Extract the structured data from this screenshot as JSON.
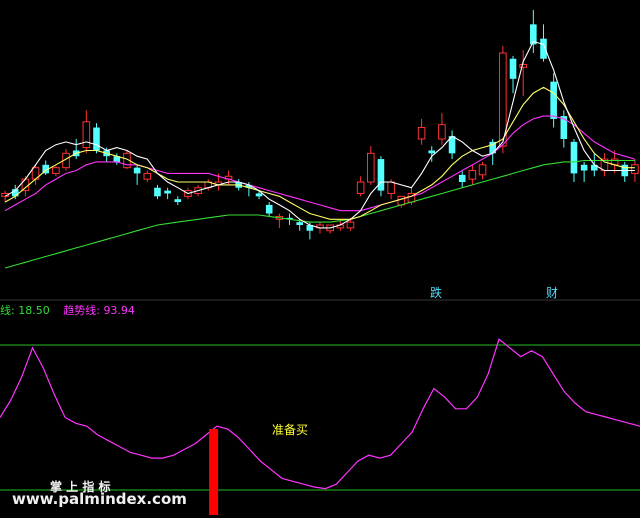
{
  "colors": {
    "up": "#ff3232",
    "down": "#54ffff",
    "ma_fast": "#ffffff",
    "ma_mid": "#ffff66",
    "ma_slow": "#ff33ff",
    "ma_long": "#33dd33",
    "indicator": "#ff33ff",
    "level_line": "#22bb22",
    "signal_bar": "#ff0000",
    "tag_label": "#55ddff",
    "buy_label": "#ffff33"
  },
  "indicator_header": {
    "line_a_label": "线:",
    "line_a_value": "18.50",
    "line_b_label": "趋势线:",
    "line_b_value": "93.94"
  },
  "tags": {
    "fall": "跌",
    "wealth": "财"
  },
  "signal_label": "准备买",
  "watermark": {
    "brand": "掌 上 指 标",
    "url": "www.palmindex.com"
  },
  "chart_data": [
    {
      "type": "candlestick",
      "title": "",
      "ylim": [
        0,
        100
      ],
      "candles": [
        [
          40,
          42,
          36,
          44
        ],
        [
          45,
          40,
          38,
          48
        ],
        [
          44,
          52,
          40,
          54
        ],
        [
          52,
          60,
          48,
          62
        ],
        [
          62,
          56,
          55,
          65
        ],
        [
          56,
          60,
          54,
          61
        ],
        [
          60,
          70,
          58,
          73
        ],
        [
          72,
          68,
          66,
          80
        ],
        [
          74,
          92,
          70,
          100
        ],
        [
          88,
          72,
          70,
          91
        ],
        [
          72,
          68,
          64,
          74
        ],
        [
          68,
          64,
          62,
          70
        ],
        [
          60,
          70,
          59,
          72
        ],
        [
          60,
          56,
          48,
          62
        ],
        [
          52,
          56,
          50,
          58
        ],
        [
          46,
          40,
          38,
          48
        ],
        [
          44,
          42,
          38,
          46
        ],
        [
          38,
          36,
          34,
          40
        ],
        [
          40,
          44,
          38,
          46
        ],
        [
          42,
          46,
          40,
          48
        ],
        [
          46,
          50,
          44,
          52
        ],
        [
          48,
          50,
          44,
          56
        ],
        [
          52,
          54,
          48,
          58
        ],
        [
          50,
          46,
          44,
          52
        ],
        [
          48,
          46,
          40,
          50
        ],
        [
          42,
          40,
          38,
          44
        ],
        [
          34,
          28,
          26,
          36
        ],
        [
          24,
          26,
          18,
          28
        ],
        [
          25,
          24,
          20,
          28
        ],
        [
          22,
          20,
          16,
          24
        ],
        [
          20,
          16,
          10,
          22
        ],
        [
          18,
          20,
          14,
          22
        ],
        [
          16,
          20,
          14,
          20
        ],
        [
          18,
          20,
          16,
          24
        ],
        [
          18,
          22,
          16,
          25
        ],
        [
          42,
          50,
          40,
          54
        ],
        [
          50,
          70,
          48,
          75
        ],
        [
          66,
          44,
          40,
          68
        ],
        [
          42,
          50,
          38,
          52
        ],
        [
          34,
          40,
          32,
          40
        ],
        [
          36,
          42,
          34,
          46
        ],
        [
          80,
          88,
          76,
          94
        ],
        [
          72,
          70,
          64,
          75
        ],
        [
          80,
          90,
          76,
          98
        ],
        [
          82,
          70,
          66,
          86
        ],
        [
          55,
          50,
          46,
          58
        ],
        [
          52,
          58,
          48,
          62
        ],
        [
          55,
          62,
          52,
          64
        ],
        [
          78,
          70,
          62,
          80
        ],
        [
          75,
          140,
          70,
          145
        ],
        [
          136,
          122,
          112,
          138
        ],
        [
          130,
          132,
          110,
          142
        ],
        [
          160,
          146,
          140,
          170
        ],
        [
          150,
          136,
          134,
          160
        ],
        [
          120,
          94,
          88,
          126
        ],
        [
          96,
          80,
          74,
          100
        ],
        [
          78,
          56,
          50,
          80
        ],
        [
          62,
          58,
          50,
          64
        ],
        [
          62,
          58,
          54,
          70
        ],
        [
          58,
          66,
          54,
          70
        ],
        [
          62,
          66,
          56,
          72
        ],
        [
          62,
          54,
          50,
          64
        ],
        [
          56,
          62,
          50,
          66
        ]
      ],
      "ma_fast": [
        40,
        44,
        52,
        62,
        72,
        76,
        78,
        76,
        78,
        76,
        72,
        74,
        72,
        68,
        66,
        56,
        50,
        46,
        42,
        44,
        46,
        48,
        50,
        50,
        48,
        44,
        38,
        34,
        30,
        24,
        20,
        18,
        18,
        20,
        24,
        30,
        42,
        50,
        50,
        48,
        46,
        56,
        68,
        74,
        82,
        78,
        72,
        68,
        70,
        78,
        106,
        134,
        148,
        146,
        128,
        106,
        88,
        72,
        62,
        58,
        58,
        58,
        58
      ],
      "ma_mid": [
        36,
        40,
        46,
        52,
        58,
        62,
        66,
        70,
        72,
        72,
        70,
        68,
        66,
        62,
        60,
        56,
        52,
        50,
        50,
        50,
        50,
        48,
        48,
        48,
        46,
        44,
        42,
        40,
        36,
        32,
        28,
        26,
        24,
        24,
        24,
        26,
        30,
        34,
        36,
        38,
        40,
        44,
        48,
        54,
        62,
        68,
        72,
        74,
        76,
        80,
        92,
        104,
        112,
        116,
        112,
        104,
        92,
        80,
        70,
        64,
        62,
        60,
        60
      ],
      "ma_slow": [
        30,
        34,
        38,
        42,
        48,
        52,
        56,
        58,
        62,
        64,
        64,
        64,
        62,
        62,
        60,
        58,
        56,
        56,
        56,
        56,
        56,
        54,
        52,
        50,
        48,
        46,
        44,
        42,
        40,
        38,
        36,
        34,
        32,
        30,
        30,
        30,
        32,
        34,
        36,
        38,
        40,
        42,
        46,
        50,
        54,
        58,
        62,
        66,
        70,
        76,
        84,
        90,
        94,
        96,
        96,
        94,
        90,
        84,
        78,
        74,
        70,
        68,
        66
      ],
      "ma_long": [
        -10,
        -8,
        -6,
        -4,
        -2,
        0,
        2,
        4,
        6,
        8,
        10,
        12,
        14,
        16,
        18,
        20,
        21,
        22,
        23,
        24,
        25,
        26,
        27,
        27,
        27,
        27,
        26,
        25,
        24,
        23,
        22,
        22,
        22,
        23,
        24,
        26,
        28,
        30,
        32,
        34,
        36,
        38,
        40,
        42,
        44,
        46,
        48,
        50,
        52,
        54,
        56,
        58,
        60,
        62,
        63,
        64,
        64,
        65,
        65,
        65,
        65,
        65,
        65
      ]
    },
    {
      "type": "line",
      "title": "",
      "ylim": [
        0,
        100
      ],
      "reference_lines": [
        100,
        0
      ],
      "series": [
        {
          "values": [
            50,
            62,
            78,
            98,
            84,
            66,
            50,
            46,
            44,
            38,
            34,
            30,
            26,
            24,
            22,
            22,
            24,
            28,
            32,
            38,
            44,
            42,
            36,
            28,
            20,
            14,
            8,
            6,
            4,
            2,
            1,
            4,
            12,
            20,
            24,
            22,
            24,
            32,
            40,
            56,
            70,
            64,
            56,
            56,
            64,
            80,
            104,
            98,
            92,
            96,
            92,
            80,
            68,
            60,
            54,
            52,
            50,
            48,
            46,
            44
          ]
        }
      ],
      "signal_index": 19
    }
  ]
}
